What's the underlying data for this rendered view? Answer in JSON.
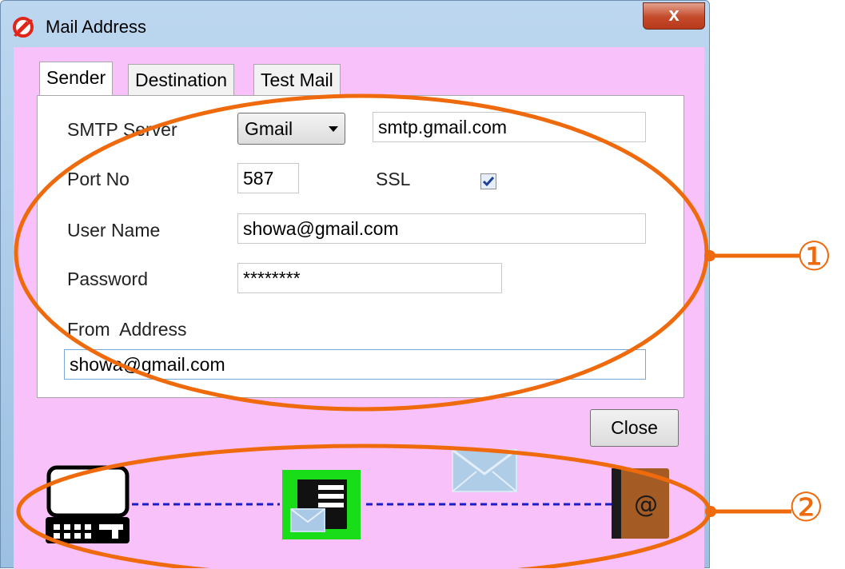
{
  "window": {
    "title": "Mail Address",
    "close_symbol": "x"
  },
  "tabs": [
    {
      "label": "Sender",
      "active": true
    },
    {
      "label": "Destination",
      "active": false
    },
    {
      "label": "Test Mail",
      "active": false
    }
  ],
  "form": {
    "smtp_label": "SMTP Server",
    "smtp_provider": "Gmail",
    "smtp_host": "smtp.gmail.com",
    "port_label": "Port No",
    "port_value": "587",
    "ssl_label": "SSL",
    "ssl_checked": true,
    "username_label": "User Name",
    "username_value": "showa@gmail.com",
    "password_label": "Password",
    "password_value": "********",
    "from_label": "From  Address",
    "from_value": "showa@gmail.com"
  },
  "buttons": {
    "close_label": "Close"
  },
  "annotations": {
    "callout_1": "①",
    "callout_2": "②",
    "accent_color": "#ef6a0c"
  },
  "diagram": {
    "icons": [
      "computer-icon",
      "mail-server-icon",
      "envelope-icon",
      "address-book-icon"
    ],
    "address_book_symbol": "@",
    "link_color": "#1c1ccc"
  }
}
